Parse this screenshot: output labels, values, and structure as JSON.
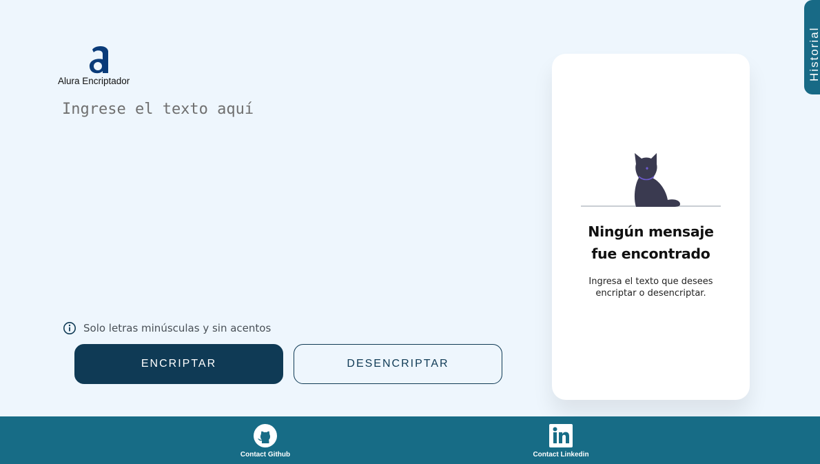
{
  "logo": {
    "mark": "a",
    "text": "Alura Encriptador",
    "color": "#0a3b79"
  },
  "input": {
    "placeholder": "Ingrese el texto aquí",
    "value": ""
  },
  "hint": {
    "icon": "info-icon",
    "text": "Solo letras minúsculas y sin acentos"
  },
  "buttons": {
    "encrypt_label": "ENCRIPTAR",
    "decrypt_label": "DESENCRIPTAR"
  },
  "result": {
    "illustration": "cat-illustration",
    "title_line1": "Ningún mensaje",
    "title_line2": "fue encontrado",
    "subtitle": "Ingresa el texto que desees encriptar o desencriptar."
  },
  "history_tab": {
    "label": "Historial"
  },
  "footer": {
    "links": [
      {
        "icon": "github-icon",
        "label": "Contact Github"
      },
      {
        "icon": "linkedin-icon",
        "label": "Contact Linkedin"
      }
    ]
  },
  "colors": {
    "background": "#eef6fd",
    "primary": "#0f3a55",
    "footer": "#176c86",
    "card": "#ffffff"
  }
}
